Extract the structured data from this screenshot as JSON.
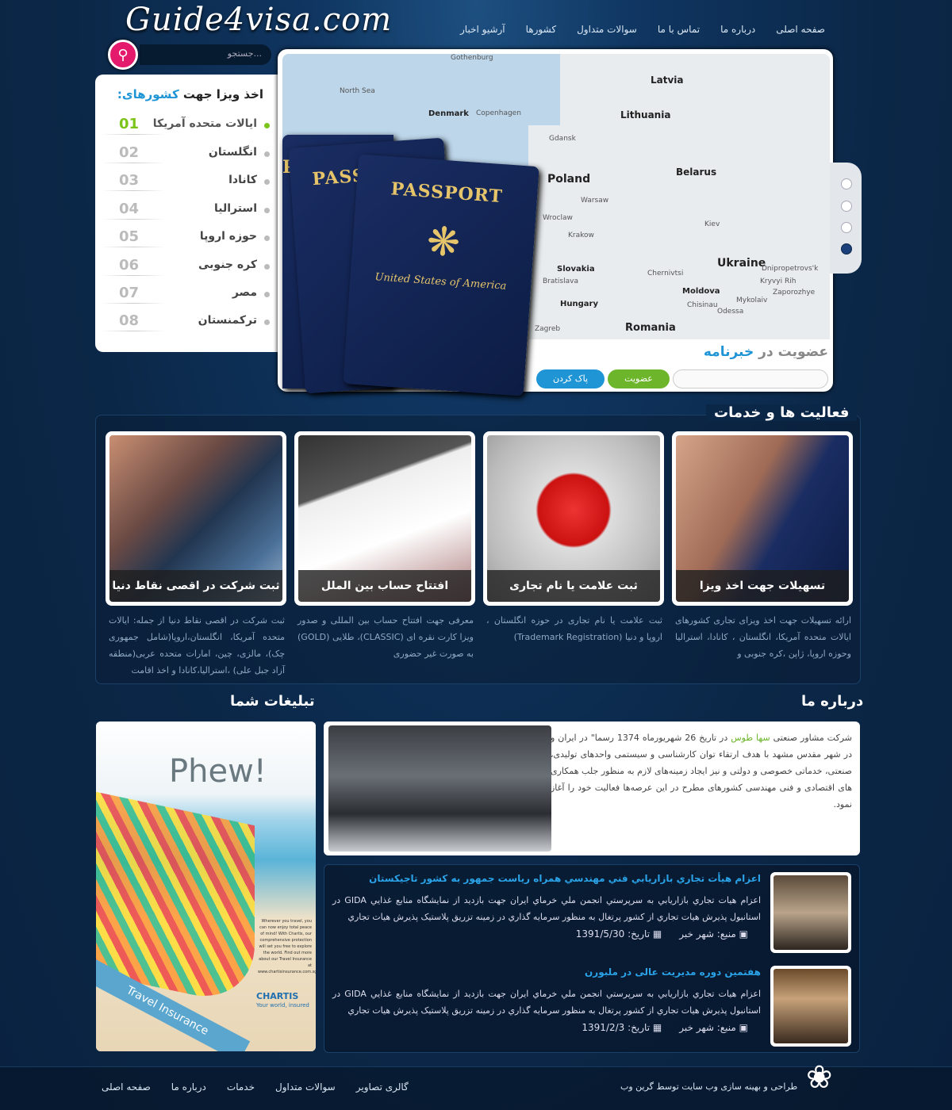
{
  "header": {
    "logo": "Guide4visa.com",
    "search_placeholder": "جستجو...",
    "nav": [
      "صفحه اصلی",
      "درباره ما",
      "تماس با ما",
      "سوالات متداول",
      "کشورها",
      "آرشیو اخبار"
    ]
  },
  "countries": {
    "title_a": "اخذ ویزا جهت",
    "title_b": "کشورهای:",
    "items": [
      {
        "num": "01",
        "name": "ایالات متحده آمریکا"
      },
      {
        "num": "02",
        "name": "انگلستان"
      },
      {
        "num": "03",
        "name": "کانادا"
      },
      {
        "num": "04",
        "name": "استرالیا"
      },
      {
        "num": "05",
        "name": "حوزه اروپا"
      },
      {
        "num": "06",
        "name": "کره جنوبی"
      },
      {
        "num": "07",
        "name": "مصر"
      },
      {
        "num": "08",
        "name": "ترکمنستان"
      }
    ]
  },
  "slider": {
    "map_labels": [
      "Latvia",
      "Lithuania",
      "Denmark",
      "Poland",
      "Belarus",
      "Ukraine",
      "Slovakia",
      "Hungary",
      "Moldova",
      "Romania",
      "North Sea",
      "Gothenburg",
      "Copenhagen",
      "Gdansk",
      "Warsaw",
      "Krakow",
      "Wroclaw",
      "Bratislava",
      "Chernivtsi",
      "Chisinau",
      "Zagreb",
      "Dnipropetrovs'k",
      "Zaporozhye",
      "Kryvyi Rih",
      "Mykolaiv",
      "Odessa",
      "Kiev"
    ],
    "passport_label": "PASSPORT",
    "passport_sub": "United States of America",
    "newsletter_a": "عضویت در",
    "newsletter_b": "خبرنامه",
    "subscribe": "عضویت",
    "clear": "پاک کردن"
  },
  "services": {
    "heading": "فعالیت ها و خدمات",
    "cards": [
      {
        "caption": "تسهیلات جهت اخذ ویزا",
        "desc": "ارائه تسهیلات جهت اخذ ویزای تجاری کشورهای ایالات متحده آمریکا، انگلستان ، کانادا، استرالیا وحوزه اروپا، ژاپن ،کره جنوبی و"
      },
      {
        "caption": "ثبت علامت یا نام تجاری",
        "desc": "ثبت علامت یا نام تجاری در حوزه انگلستان ، اروپا و دنیا (Trademark Registration)"
      },
      {
        "caption": "افتتاح حساب بین الملل",
        "desc": "معرفی جهت افتتاح حساب بین المللی و صدور ویزا کارت نقره ای (CLASSIC)، طلایی (GOLD) به صورت غیر حضوری"
      },
      {
        "caption": "ثبت شرکت در اقصی نقاط دنیا",
        "desc": "ثبت شرکت در اقصی نقاط دنیا از جمله: ایالات متحده آمریکا، انگلستان،اروپا(شامل جمهوری چک)، مالزی، چین، امارات متحده عربی(منطقه آزاد جبل علی) ،استرالیا،کانادا و اخذ اقامت"
      }
    ]
  },
  "about": {
    "heading": "درباره ما",
    "text_a": "شرکت مشاور صنعتی",
    "text_highlight": "سها طوس",
    "text_b": "در تاریخ 26 شهریورماه 1374 رسما\" در ایران و در شهر مقدس مشهد با هدف ارتقاء توان کارشناسی و سیستمی واحدهای تولیدی، صنعتی، خدماتی خصوصی و دولتی و نیز ایجاد زمینه‌های لازم به منظور جلب همکاری های اقتصادی و فنی مهندسی کشورهای مطرح در این عرصه‌ها فعالیت خود را آغاز نمود."
  },
  "ads": {
    "heading": "تبلیغات شما",
    "headline": "Phew!",
    "brand": "CHARTIS",
    "tagline": "Your world, insured",
    "product": "Travel Insurance",
    "blurb": "Wherever you travel, you can now enjoy total peace of mind! With Chartis, our comprehensive protection will set you free to explore the world. Find out more about our Travel Insurance at www.chartisinsurance.com.sg"
  },
  "news": [
    {
      "title": "اعزام هیأت تجاري بازاريابي فني مهندسي همراه رياست جمهور به كشور تاجيكستان",
      "body": "اعزام هيات تجاري بازاريابي به سرپرستي انجمن ملي خرماي ايران جهت بازديد از نمايشگاه منابع غذايي GIDA در استانبول پذيرش هيات تجاري از كشور پرتغال به منظور سرمايه گذاري در زمينه تزريق پلاستيک پذيرش هيات تجاري",
      "source": "منبع: شهر خبر",
      "date": "تاریخ: 1391/5/30"
    },
    {
      "title": "هفتمین دوره مدیریت عالی در ملبورن",
      "body": "اعزام هيات تجاري بازاريابي به سرپرستي انجمن ملي خرماي ايران جهت بازديد از نمايشگاه منابع غذايي GIDA در استانبول پذيرش هيات تجاري از كشور پرتغال به منظور سرمايه گذاري در زمينه تزريق پلاستيک پذيرش هيات تجاري",
      "source": "منبع: شهر خبر",
      "date": "تاریخ: 1391/2/3"
    }
  ],
  "footer": {
    "nav": [
      "صفحه اصلی",
      "درباره ما",
      "خدمات",
      "سوالات متداول",
      "گالری تصاویر"
    ],
    "credit": "طراحی و بهینه سازی وب سایت توسط گرین وب"
  },
  "colors": {
    "accent": "#1f95d6",
    "green": "#6db52a",
    "search": "#e41a6c",
    "bg": "#0b2747"
  }
}
